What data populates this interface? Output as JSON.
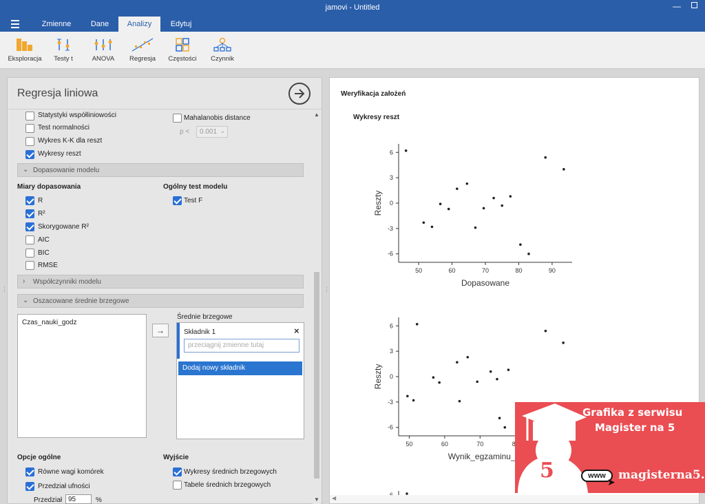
{
  "window": {
    "title": "jamovi - Untitled"
  },
  "tabs": [
    {
      "label": "Zmienne"
    },
    {
      "label": "Dane"
    },
    {
      "label": "Analizy"
    },
    {
      "label": "Edytuj"
    }
  ],
  "ribbon": [
    {
      "label": "Eksploracja",
      "icon": "bar-chart-icon"
    },
    {
      "label": "Testy t",
      "icon": "t-test-icon"
    },
    {
      "label": "ANOVA",
      "icon": "anova-icon"
    },
    {
      "label": "Regresja",
      "icon": "regression-icon"
    },
    {
      "label": "Częstości",
      "icon": "frequencies-icon"
    },
    {
      "label": "Czynnik",
      "icon": "factor-icon"
    }
  ],
  "panel": {
    "title": "Regresja liniowa",
    "checks_top": [
      {
        "label": "Statystyki współliniowości",
        "checked": false
      },
      {
        "label": "Test normalności",
        "checked": false
      },
      {
        "label": "Wykres K-K dla reszt",
        "checked": false
      },
      {
        "label": "Wykresy reszt",
        "checked": true
      }
    ],
    "mahal": {
      "label": "Mahalanobis distance",
      "p_label": "p <",
      "p_value": "0.001"
    },
    "sec_fit": "Dopasowanie modelu",
    "fit_measures_title": "Miary dopasowania",
    "fit_measures": [
      {
        "label": "R",
        "checked": true
      },
      {
        "label": "R²",
        "checked": true
      },
      {
        "label": "Skorygowane R²",
        "checked": true
      },
      {
        "label": "AIC",
        "checked": false
      },
      {
        "label": "BIC",
        "checked": false
      },
      {
        "label": "RMSE",
        "checked": false
      }
    ],
    "overall_title": "Ogólny test modelu",
    "overall_f": {
      "label": "Test F",
      "checked": true
    },
    "sec_coef": "Współczynniki modelu",
    "sec_emm": "Oszacowane średnie brzegowe",
    "var_list": [
      "Czas_nauki_godz"
    ],
    "emm_label": "Średnie brzegowe",
    "term_label": "Składnik 1",
    "drop_placeholder": "przeciągnij zmienne tutaj",
    "add_term": "Dodaj nowy składnik",
    "general_title": "Opcje ogólne",
    "general": [
      {
        "label": "Równe wagi komórek",
        "checked": true
      },
      {
        "label": "Przedział ufności",
        "checked": true
      }
    ],
    "interval_label": "Przedział",
    "interval_value": "95",
    "interval_unit": "%",
    "output_title": "Wyjście",
    "output": [
      {
        "label": "Wykresy średnich brzegowych",
        "checked": true
      },
      {
        "label": "Tabele średnich brzegowych",
        "checked": false
      }
    ]
  },
  "results": {
    "heading": "Weryfikacja założeń",
    "subheading": "Wykresy reszt"
  },
  "chart_data": [
    {
      "type": "scatter",
      "xlabel": "Dopasowane",
      "ylabel": "Reszty",
      "xlim": [
        44,
        96
      ],
      "ylim": [
        -7,
        7
      ],
      "xticks": [
        50,
        60,
        70,
        80,
        90
      ],
      "yticks": [
        -6,
        -3,
        0,
        3,
        6
      ],
      "points": [
        [
          46.2,
          6.2
        ],
        [
          51.5,
          -2.3
        ],
        [
          54.0,
          -2.8
        ],
        [
          56.5,
          -0.1
        ],
        [
          59.0,
          -0.7
        ],
        [
          61.5,
          1.7
        ],
        [
          64.5,
          2.3
        ],
        [
          67.0,
          -2.9
        ],
        [
          69.5,
          -0.6
        ],
        [
          72.5,
          0.6
        ],
        [
          75.0,
          -0.3
        ],
        [
          77.5,
          0.8
        ],
        [
          80.5,
          -4.9
        ],
        [
          83.0,
          -6.0
        ],
        [
          88.0,
          5.4
        ],
        [
          93.5,
          4.0
        ]
      ]
    },
    {
      "type": "scatter",
      "xlabel": "Wynik_egzaminu_pr",
      "ylabel": "Reszty",
      "xlim": [
        47,
        96
      ],
      "ylim": [
        -7,
        7
      ],
      "xticks": [
        50,
        60,
        70,
        80
      ],
      "yticks": [
        -6,
        -3,
        0,
        3,
        6
      ],
      "points": [
        [
          49.5,
          -2.3
        ],
        [
          51.2,
          -2.8
        ],
        [
          52.2,
          6.2
        ],
        [
          56.8,
          -0.1
        ],
        [
          58.5,
          -0.7
        ],
        [
          63.5,
          1.7
        ],
        [
          64.2,
          -2.9
        ],
        [
          66.5,
          2.3
        ],
        [
          69.2,
          -0.6
        ],
        [
          73.0,
          0.6
        ],
        [
          74.8,
          -0.3
        ],
        [
          75.5,
          -4.9
        ],
        [
          77.0,
          -6.0
        ],
        [
          78.0,
          0.8
        ],
        [
          88.5,
          5.4
        ],
        [
          93.5,
          4.0
        ]
      ]
    }
  ],
  "third_plot_tick": "6",
  "promo": {
    "line1": "Grafika z serwisu",
    "line2": "Magister na 5",
    "badge": "5",
    "www": "www",
    "site": "magisterna5.pl"
  }
}
